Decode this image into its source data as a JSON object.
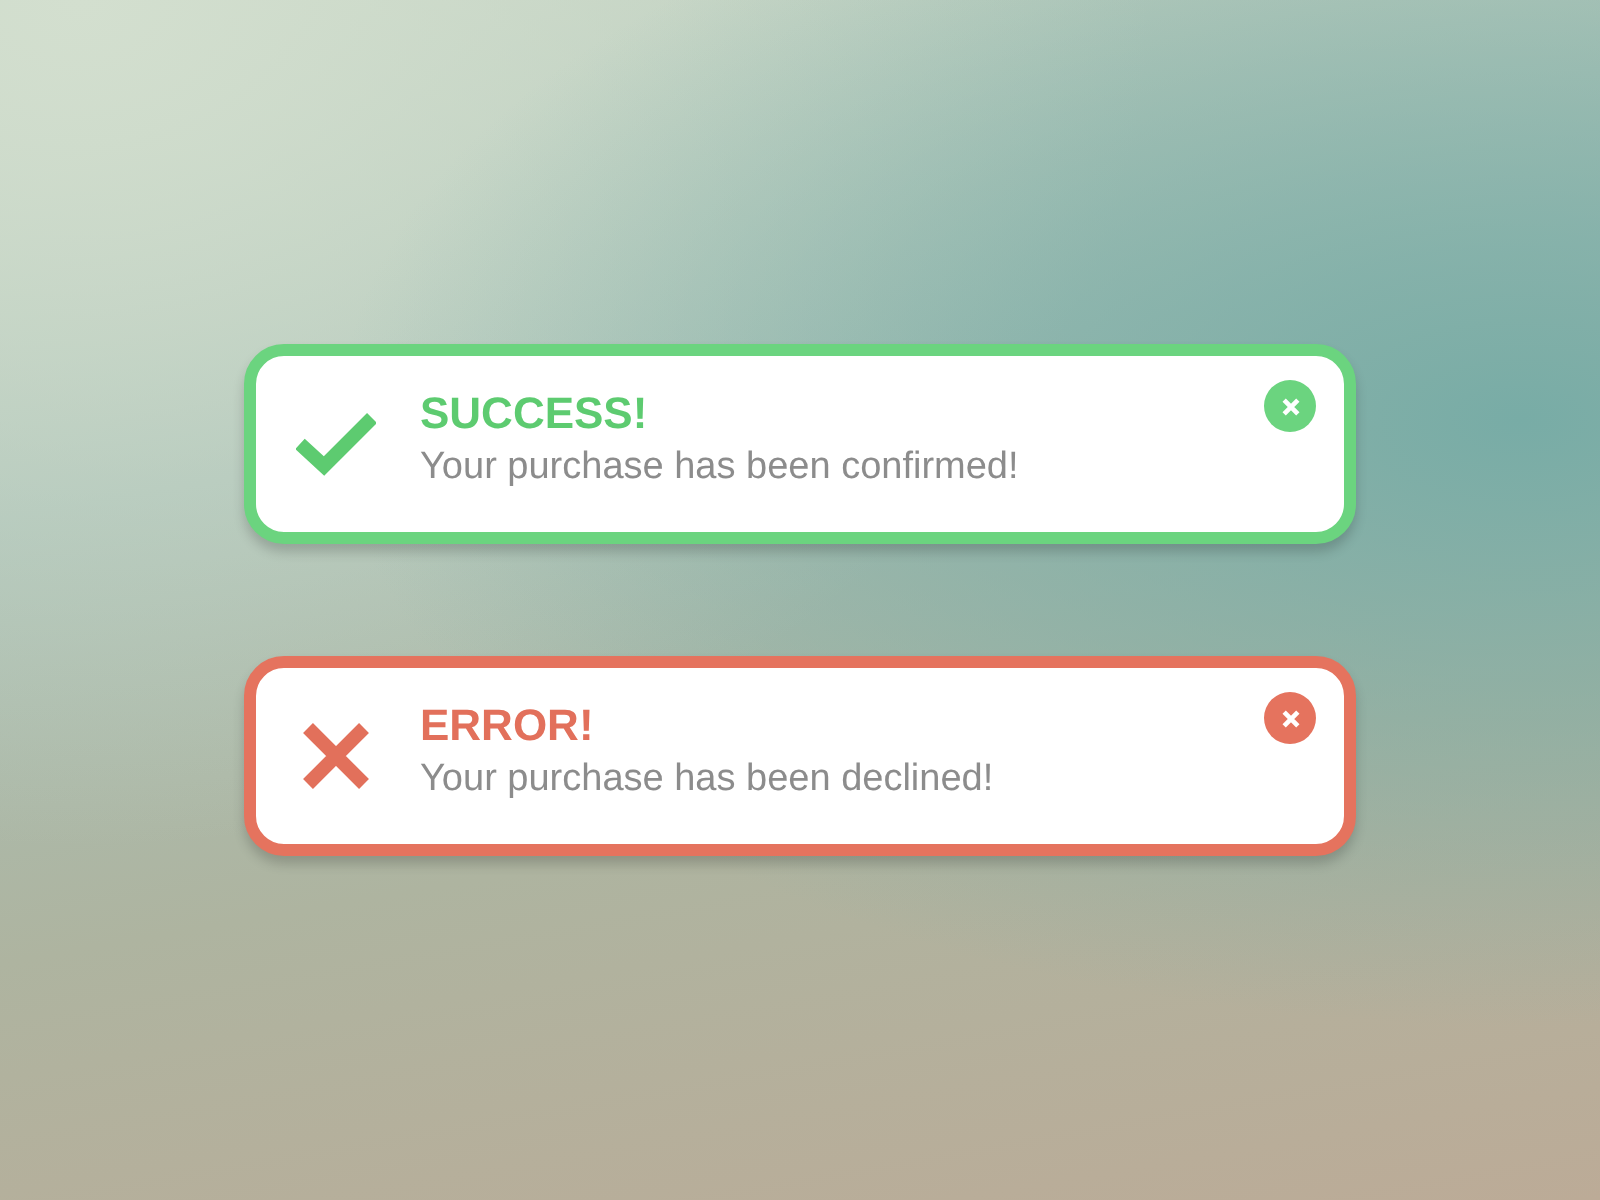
{
  "alerts": [
    {
      "kind": "success",
      "title": "SUCCESS!",
      "message": "Your purchase has been confirmed!"
    },
    {
      "kind": "error",
      "title": "ERROR!",
      "message": "Your purchase has been declined!"
    }
  ]
}
